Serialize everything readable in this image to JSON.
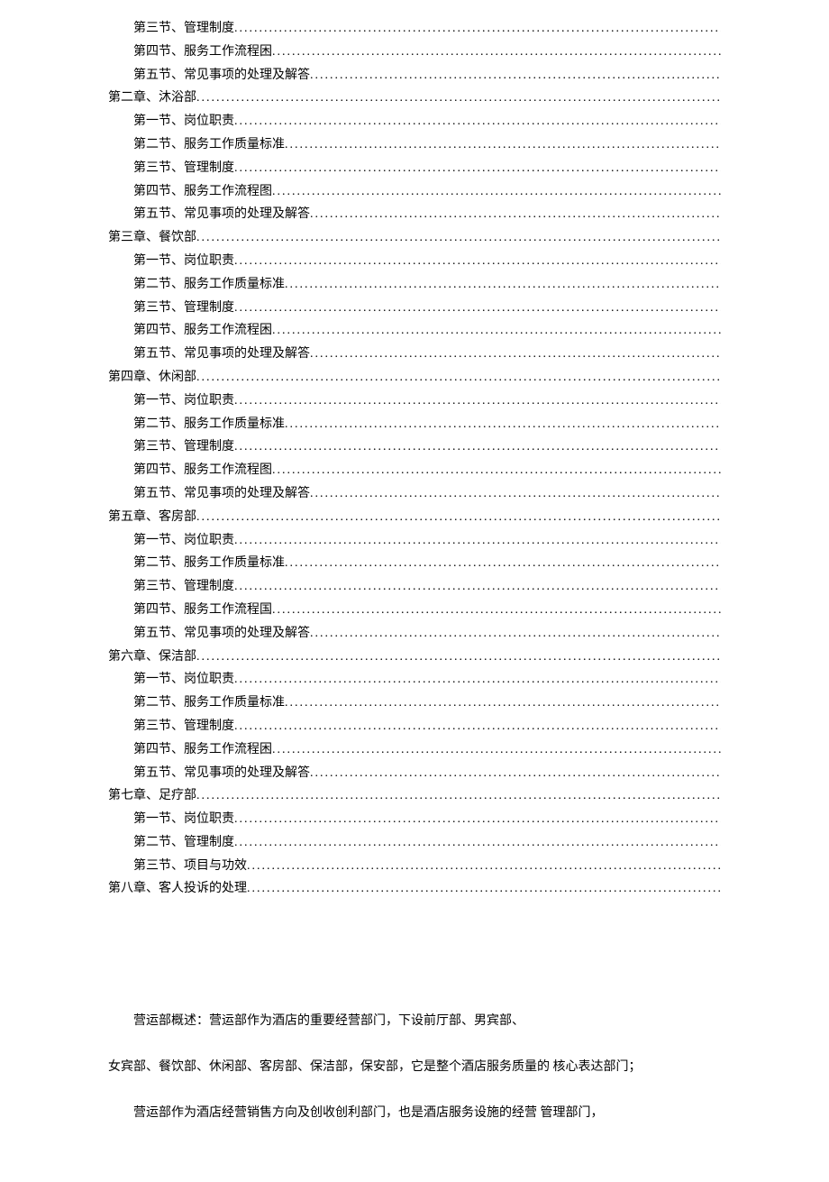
{
  "toc": [
    {
      "level": 2,
      "label": "第三节、管理制度"
    },
    {
      "level": 2,
      "label": "第四节、服务工作流程困"
    },
    {
      "level": 2,
      "label": "第五节、常见事项的处理及解答"
    },
    {
      "level": 1,
      "label": "第二章、沐浴部"
    },
    {
      "level": 2,
      "label": "第一节、岗位职责"
    },
    {
      "level": 2,
      "label": "第二节、服务工作质量标准"
    },
    {
      "level": 2,
      "label": "第三节、管理制度"
    },
    {
      "level": 2,
      "label": "第四节、服务工作流程图"
    },
    {
      "level": 2,
      "label": "第五节、常见事项的处理及解答"
    },
    {
      "level": 1,
      "label": "第三章、餐饮部"
    },
    {
      "level": 2,
      "label": "第一节、岗位职责"
    },
    {
      "level": 2,
      "label": "第二节、服务工作质量标准"
    },
    {
      "level": 2,
      "label": "第三节、管理制度"
    },
    {
      "level": 2,
      "label": "第四节、服务工作流程困"
    },
    {
      "level": 2,
      "label": "第五节、常见事项的处理及解答"
    },
    {
      "level": 1,
      "label": "第四章、休闲部"
    },
    {
      "level": 2,
      "label": "第一节、岗位职责"
    },
    {
      "level": 2,
      "label": "第二节、服务工作质量标准"
    },
    {
      "level": 2,
      "label": "第三节、管理制度"
    },
    {
      "level": 2,
      "label": "第四节、服务工作流程图"
    },
    {
      "level": 2,
      "label": "第五节、常见事项的处理及解答"
    },
    {
      "level": 1,
      "label": "第五章、客房部"
    },
    {
      "level": 2,
      "label": "第一节、岗位职责"
    },
    {
      "level": 2,
      "label": "第二节、服务工作质量标准"
    },
    {
      "level": 2,
      "label": "第三节、管理制度"
    },
    {
      "level": 2,
      "label": "第四节、服务工作流程国"
    },
    {
      "level": 2,
      "label": "第五节、常见事项的处理及解答"
    },
    {
      "level": 1,
      "label": "第六章、保洁部"
    },
    {
      "level": 2,
      "label": "第一节、岗位职责"
    },
    {
      "level": 2,
      "label": "第二节、服务工作质量标准"
    },
    {
      "level": 2,
      "label": "第三节、管理制度"
    },
    {
      "level": 2,
      "label": "第四节、服务工作流程困"
    },
    {
      "level": 2,
      "label": "第五节、常见事项的处理及解答"
    },
    {
      "level": 1,
      "label": "第七章、足疗部"
    },
    {
      "level": 2,
      "label": "第一节、岗位职责"
    },
    {
      "level": 2,
      "label": "第二节、管理制度"
    },
    {
      "level": 2,
      "label": "第三节、项目与功效"
    },
    {
      "level": 1,
      "label": "第八章、客人投诉的处理"
    }
  ],
  "body": {
    "p1": "营运部概述：营运部作为酒店的重要经营部门，下设前厅部、男宾部、",
    "p2": "女宾部、餐饮部、休闲部、客房部、保洁部，保安部，它是整个酒店服务质量的 核心表达部门；",
    "p3": "营运部作为酒店经营销售方向及创收创利部门，也是酒店服务设施的经营 管理部门，"
  }
}
